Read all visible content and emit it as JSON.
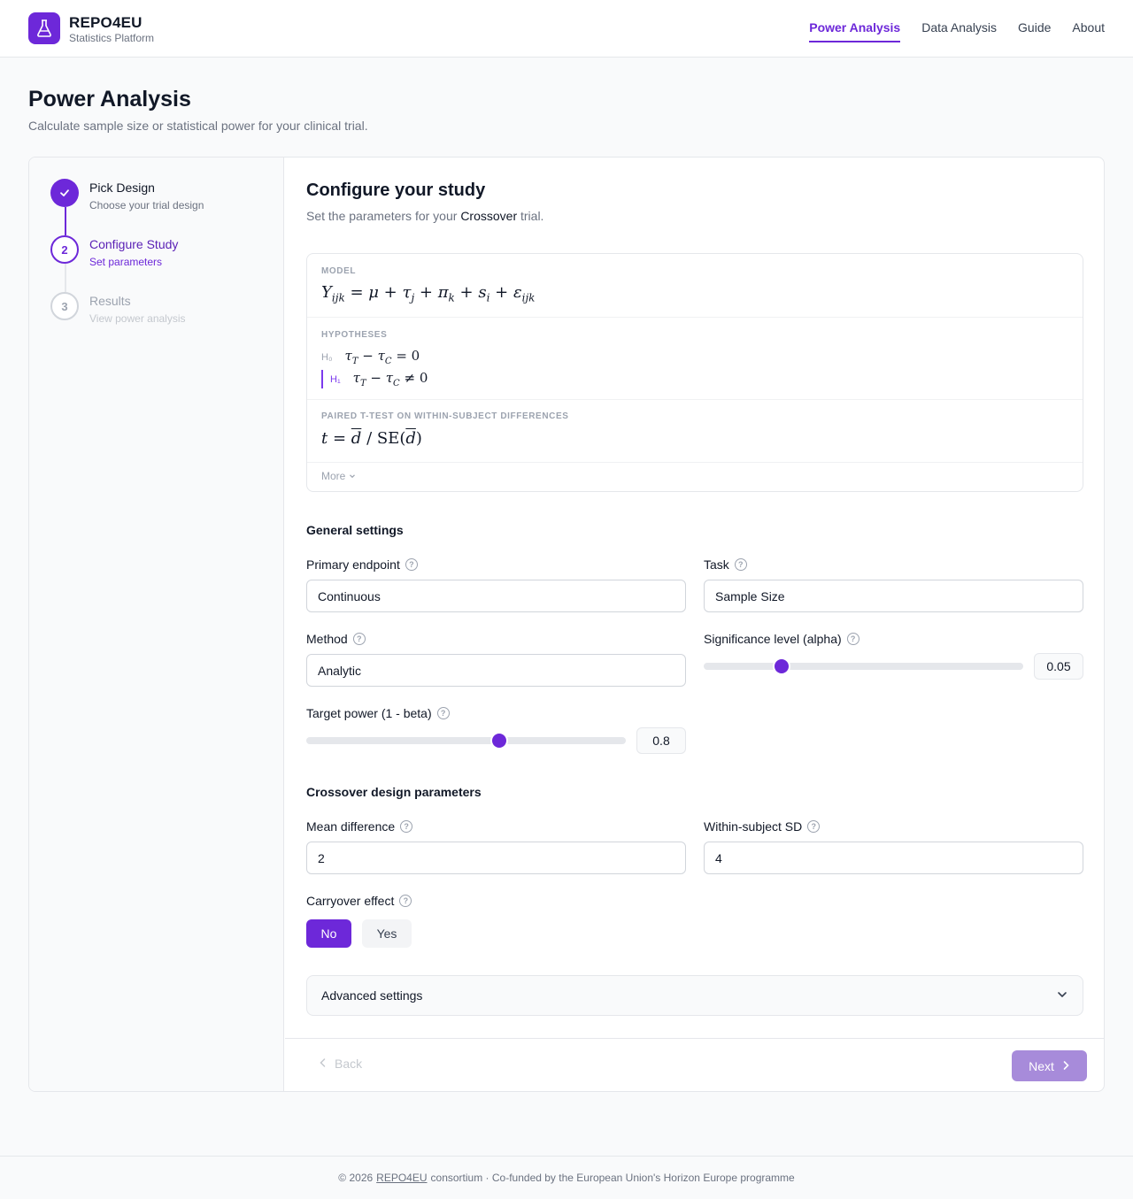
{
  "header": {
    "brand_name": "REPO4EU",
    "brand_sub": "Statistics Platform",
    "logo_icon": "flask-icon",
    "nav": [
      {
        "label": "Power Analysis",
        "active": true
      },
      {
        "label": "Data Analysis",
        "active": false
      },
      {
        "label": "Guide",
        "active": false
      },
      {
        "label": "About",
        "active": false
      }
    ]
  },
  "page": {
    "title": "Power Analysis",
    "subtitle": "Calculate sample size or statistical power for your clinical trial."
  },
  "stepper": [
    {
      "number": "1",
      "title": "Pick Design",
      "desc": "Choose your trial design",
      "state": "complete"
    },
    {
      "number": "2",
      "title": "Configure Study",
      "desc": "Set parameters",
      "state": "current"
    },
    {
      "number": "3",
      "title": "Results",
      "desc": "View power analysis",
      "state": "upcoming"
    }
  ],
  "main": {
    "title": "Configure your study",
    "subtitle_pre": "Set the parameters for your",
    "design": "Crossover",
    "subtitle_post": "trial.",
    "model": {
      "model_label": "MODEL",
      "hypotheses_label": "HYPOTHESES",
      "h0_tag": "H₀",
      "h1_tag": "H₁",
      "test_label": "PAIRED T-TEST ON WITHIN-SUBJECT DIFFERENCES",
      "more_label": "More"
    },
    "general": {
      "title": "General settings",
      "primary_endpoint": {
        "label": "Primary endpoint",
        "value": "Continuous"
      },
      "task": {
        "label": "Task",
        "value": "Sample Size"
      },
      "method": {
        "label": "Method",
        "value": "Analytic"
      },
      "alpha": {
        "label": "Significance level (alpha)",
        "value": "0.05",
        "fraction": 0.245
      },
      "power": {
        "label": "Target power (1 - beta)",
        "value": "0.8",
        "fraction": 0.605
      }
    },
    "crossover": {
      "title": "Crossover design parameters",
      "mean_diff": {
        "label": "Mean difference",
        "value": "2"
      },
      "within_sd": {
        "label": "Within-subject SD",
        "value": "4"
      },
      "carryover": {
        "label": "Carryover effect",
        "options": [
          "No",
          "Yes"
        ],
        "selected": "No"
      }
    },
    "advanced_label": "Advanced settings",
    "back_label": "Back",
    "next_label": "Next"
  },
  "footer": {
    "pre": "© 2026",
    "link": "REPO4EU",
    "post": "consortium · Co-funded by the European Union's Horizon Europe programme"
  },
  "colors": {
    "accent": "#6d28d9",
    "accent_light": "#a78bda"
  }
}
